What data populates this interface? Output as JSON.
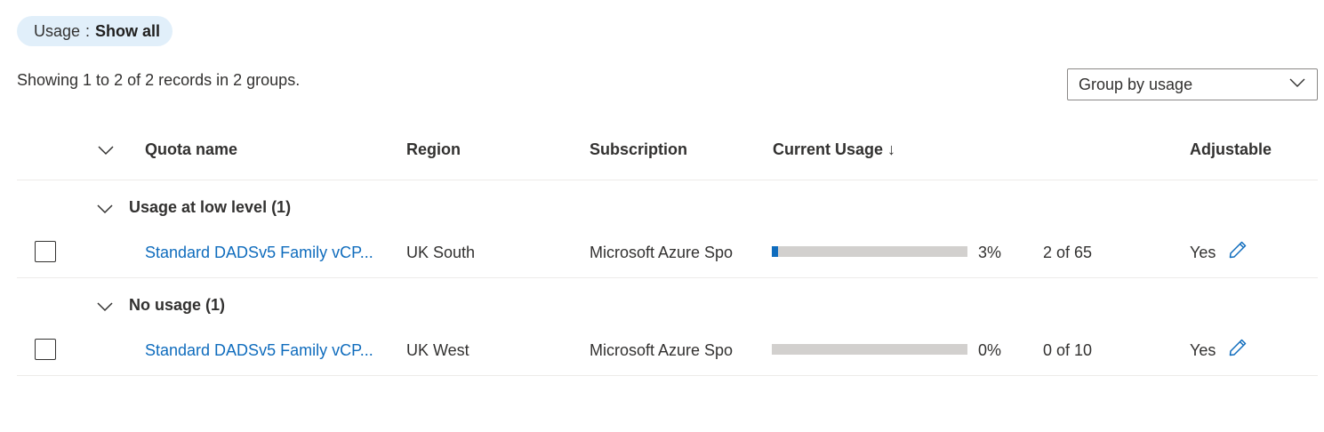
{
  "filter": {
    "label": "Usage",
    "separator": ":",
    "value": "Show all"
  },
  "records_info": "Showing 1 to 2 of 2 records in 2 groups.",
  "group_by": {
    "selected": "Group by usage"
  },
  "columns": {
    "quota_name": "Quota name",
    "region": "Region",
    "subscription": "Subscription",
    "current_usage": "Current Usage ↓",
    "adjustable": "Adjustable"
  },
  "groups": [
    {
      "title": "Usage at low level (1)",
      "rows": [
        {
          "quota_name": "Standard DADSv5 Family vCP...",
          "region": "UK South",
          "subscription": "Microsoft Azure Spo",
          "usage_percent": 3,
          "usage_percent_label": "3%",
          "usage_count": "2 of 65",
          "adjustable": "Yes"
        }
      ]
    },
    {
      "title": "No usage (1)",
      "rows": [
        {
          "quota_name": "Standard DADSv5 Family vCP...",
          "region": "UK West",
          "subscription": "Microsoft Azure Spo",
          "usage_percent": 0,
          "usage_percent_label": "0%",
          "usage_count": "0 of 10",
          "adjustable": "Yes"
        }
      ]
    }
  ],
  "colors": {
    "accent": "#0f6cbd",
    "pill_bg": "#e1effa",
    "bar_track": "#d2d0ce"
  }
}
